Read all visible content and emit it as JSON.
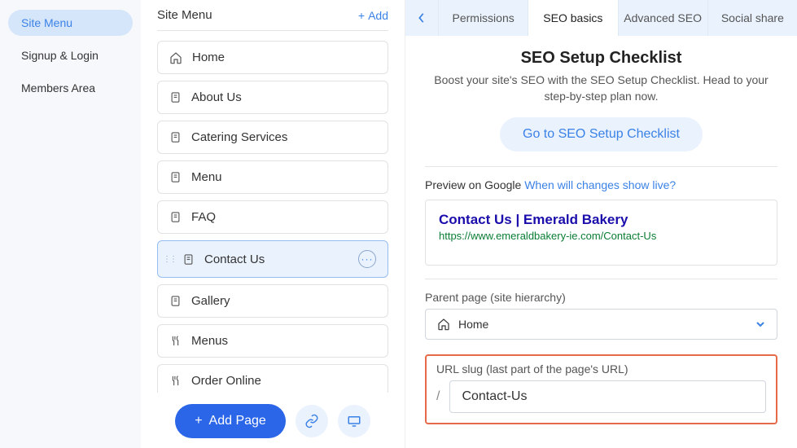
{
  "leftSidebar": {
    "items": [
      {
        "label": "Site Menu",
        "active": true
      },
      {
        "label": "Signup & Login",
        "active": false
      },
      {
        "label": "Members Area",
        "active": false
      }
    ]
  },
  "middle": {
    "title": "Site Menu",
    "addLabel": "Add",
    "pages": [
      {
        "icon": "home",
        "label": "Home"
      },
      {
        "icon": "page",
        "label": "About Us"
      },
      {
        "icon": "page",
        "label": "Catering Services"
      },
      {
        "icon": "page",
        "label": "Menu"
      },
      {
        "icon": "page",
        "label": "FAQ"
      },
      {
        "icon": "page",
        "label": "Contact Us",
        "selected": true
      },
      {
        "icon": "page",
        "label": "Gallery"
      },
      {
        "icon": "fork",
        "label": "Menus"
      },
      {
        "icon": "fork",
        "label": "Order Online"
      }
    ],
    "addPageLabel": "Add Page"
  },
  "right": {
    "tabs": [
      {
        "label": "Permissions"
      },
      {
        "label": "SEO basics",
        "active": true
      },
      {
        "label": "Advanced SEO"
      },
      {
        "label": "Social share"
      }
    ],
    "checklist": {
      "title": "SEO Setup Checklist",
      "subtitle": "Boost your site's SEO with the SEO Setup Checklist. Head to your step-by-step plan now.",
      "button": "Go to SEO Setup Checklist"
    },
    "preview": {
      "label": "Preview on Google",
      "link": "When will changes show live?",
      "title": "Contact Us | Emerald Bakery",
      "url": "https://www.emeraldbakery-ie.com/Contact-Us"
    },
    "parent": {
      "label": "Parent page (site hierarchy)",
      "value": "Home"
    },
    "slug": {
      "label": "URL slug (last part of the page's URL)",
      "prefix": "/",
      "value": "Contact-Us"
    }
  }
}
